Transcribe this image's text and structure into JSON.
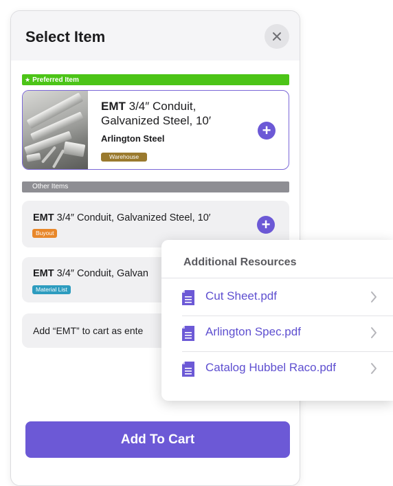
{
  "dialog": {
    "title": "Select Item",
    "close_icon": "close-icon"
  },
  "preferred": {
    "section_label": "Preferred Item",
    "item": {
      "brand": "EMT",
      "description": " 3/4″ Conduit, Galvanized Steel, 10′",
      "vendor": "Arlington Steel",
      "badge": "Warehouse"
    }
  },
  "other": {
    "section_label": "Other Items",
    "items": [
      {
        "brand": "EMT",
        "description": " 3/4″ Conduit, Galvanized Steel, 10′",
        "badge": "Buyout"
      },
      {
        "brand": "EMT",
        "description": " 3/4″ Conduit, Galvan",
        "badge": "Material List"
      }
    ],
    "add_entered": "Add “EMT” to cart as ente"
  },
  "footer": {
    "add_to_cart": "Add To Cart"
  },
  "resources": {
    "title": "Additional Resources",
    "files": [
      {
        "name": "Cut Sheet.pdf"
      },
      {
        "name": "Arlington Spec.pdf"
      },
      {
        "name": "Catalog Hubbel Raco.pdf"
      }
    ]
  },
  "colors": {
    "accent": "#6c59d6",
    "preferred_green": "#4cc417",
    "other_gray": "#8e8e93",
    "warehouse": "#9a7a2e",
    "buyout": "#e8872a",
    "material_list": "#2d9cbf"
  }
}
